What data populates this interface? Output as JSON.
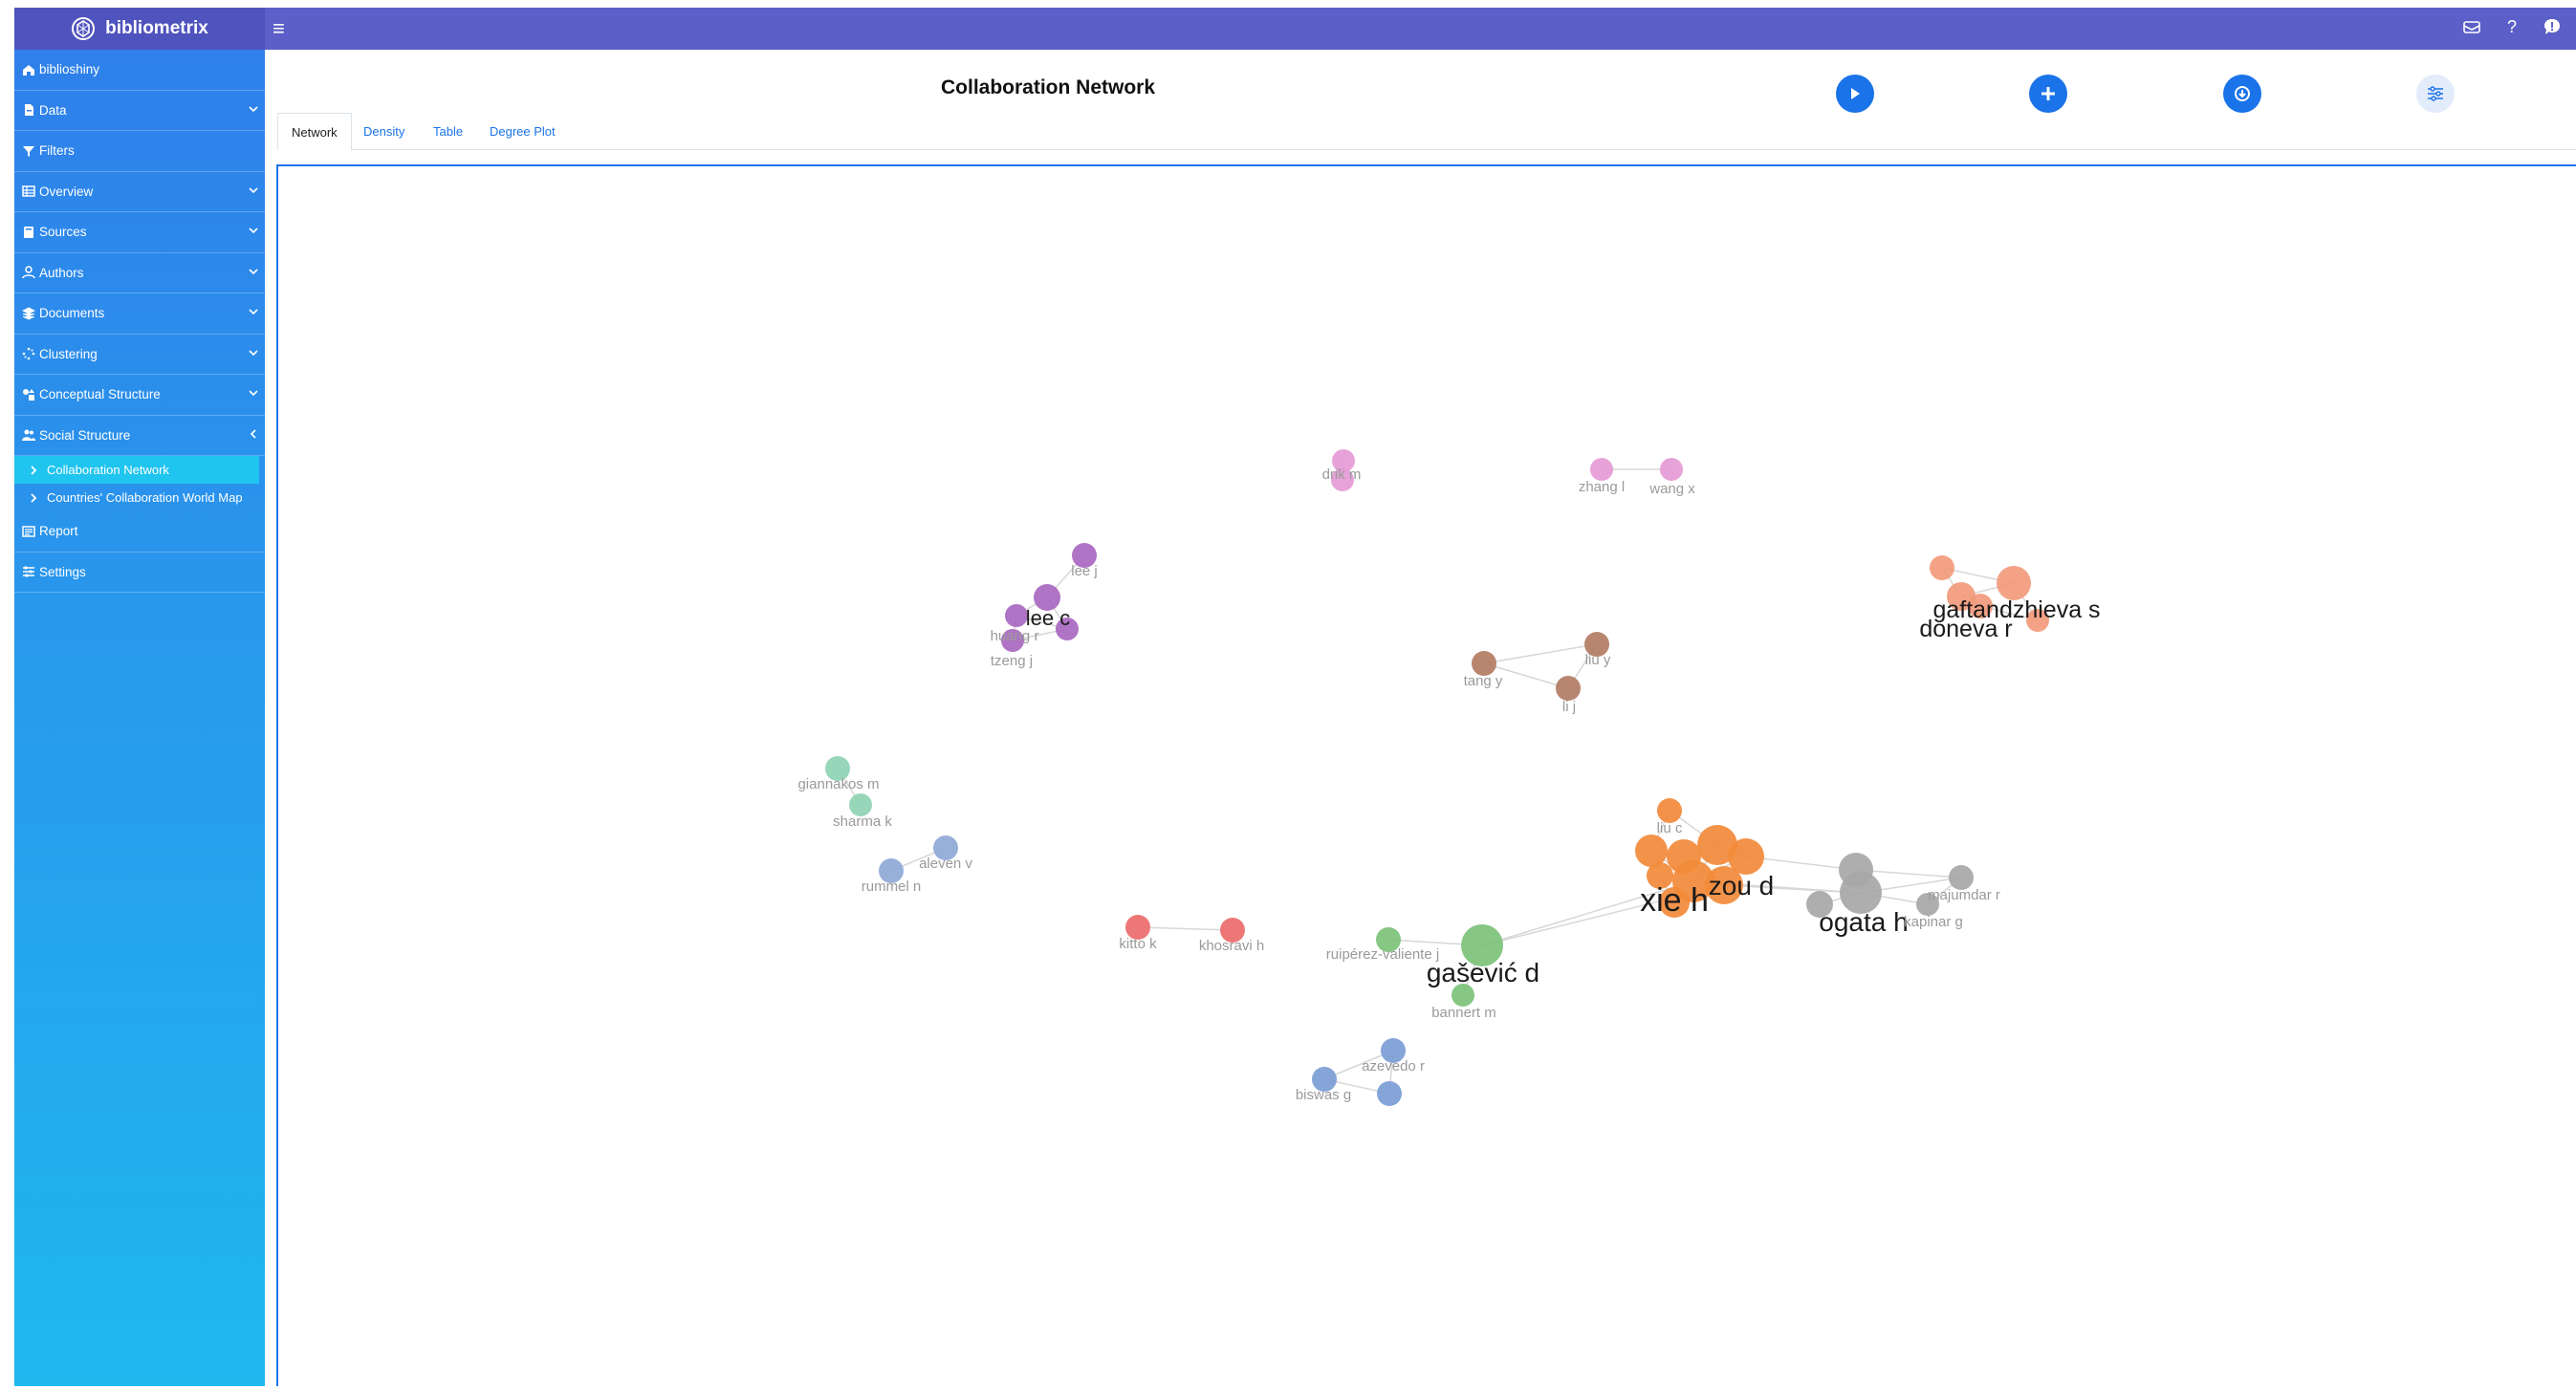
{
  "app": {
    "brand": "bibliometrix"
  },
  "header": {
    "icons": [
      "menu-icon",
      "mail-icon",
      "help-icon",
      "chat-icon"
    ],
    "help_glyph": "?"
  },
  "sidebar": {
    "items": [
      {
        "label": "biblioshiny",
        "icon": "home-icon",
        "has_chevron": false
      },
      {
        "label": "Data",
        "icon": "file-icon",
        "has_chevron": true
      },
      {
        "label": "Filters",
        "icon": "filter-icon",
        "has_chevron": false
      },
      {
        "label": "Overview",
        "icon": "table-icon",
        "has_chevron": true
      },
      {
        "label": "Sources",
        "icon": "book-icon",
        "has_chevron": true
      },
      {
        "label": "Authors",
        "icon": "user-icon",
        "has_chevron": true
      },
      {
        "label": "Documents",
        "icon": "layers-icon",
        "has_chevron": true
      },
      {
        "label": "Clustering",
        "icon": "spinner-icon",
        "has_chevron": true
      },
      {
        "label": "Conceptual Structure",
        "icon": "shapes-icon",
        "has_chevron": true
      },
      {
        "label": "Social Structure",
        "icon": "users-icon",
        "has_chevron": true,
        "expanded": true
      }
    ],
    "subitems": [
      {
        "label": "Collaboration Network",
        "active": true
      },
      {
        "label": "Countries' Collaboration World Map",
        "active": false
      }
    ],
    "bottom_items": [
      {
        "label": "Report",
        "icon": "report-icon"
      },
      {
        "label": "Settings",
        "icon": "sliders-icon"
      }
    ]
  },
  "main": {
    "title": "Collaboration Network",
    "actions": [
      "play-icon",
      "plus-icon",
      "download-icon",
      "options-icon"
    ],
    "tabs": [
      {
        "label": "Network",
        "active": true
      },
      {
        "label": "Density",
        "active": false
      },
      {
        "label": "Table",
        "active": false
      },
      {
        "label": "Degree Plot",
        "active": false
      }
    ]
  },
  "network": {
    "colors": {
      "pink": "#e59bd6",
      "purple": "#a868c0",
      "brown": "#b27b63",
      "coral": "#f29a7b",
      "orange": "#f28a3a",
      "gray": "#a7a7a7",
      "green": "#7cc27a",
      "teal": "#8fd3b4",
      "blue": "#8fa8d6",
      "darkblue": "#7b9dd6",
      "red": "#ec6b6b",
      "label": "#9a9a9a",
      "bigLabel": "#1a1a1a"
    },
    "labels": [
      {
        "text": "drik m",
        "group": "pink"
      },
      {
        "text": "zhang l",
        "group": "pink"
      },
      {
        "text": "wang x",
        "group": "pink"
      },
      {
        "text": "lee j",
        "group": "purple"
      },
      {
        "text": "lee c",
        "group": "purple"
      },
      {
        "text": "huang r",
        "group": "purple"
      },
      {
        "text": "tzeng j",
        "group": "purple"
      },
      {
        "text": "gaftandzhieva s",
        "group": "coral"
      },
      {
        "text": "doneva r",
        "group": "coral"
      },
      {
        "text": "tang y",
        "group": "brown"
      },
      {
        "text": "liu y",
        "group": "brown"
      },
      {
        "text": "li j",
        "group": "brown"
      },
      {
        "text": "giannakos m",
        "group": "teal"
      },
      {
        "text": "sharma k",
        "group": "teal"
      },
      {
        "text": "aleven v",
        "group": "blue"
      },
      {
        "text": "rummel n",
        "group": "blue"
      },
      {
        "text": "liu c",
        "group": "orange"
      },
      {
        "text": "xie h",
        "group": "orange"
      },
      {
        "text": "zou d",
        "group": "orange"
      },
      {
        "text": "majumdar r",
        "group": "gray"
      },
      {
        "text": "ogata h",
        "group": "gray"
      },
      {
        "text": "kapinar g",
        "group": "gray"
      },
      {
        "text": "kitto k",
        "group": "red"
      },
      {
        "text": "khosravi h",
        "group": "red"
      },
      {
        "text": "ruipérez-valiente j",
        "group": "green"
      },
      {
        "text": "gašević d",
        "group": "green"
      },
      {
        "text": "bannert m",
        "group": "green"
      },
      {
        "text": "azevedo r",
        "group": "darkblue"
      },
      {
        "text": "biswas g",
        "group": "darkblue"
      }
    ]
  }
}
